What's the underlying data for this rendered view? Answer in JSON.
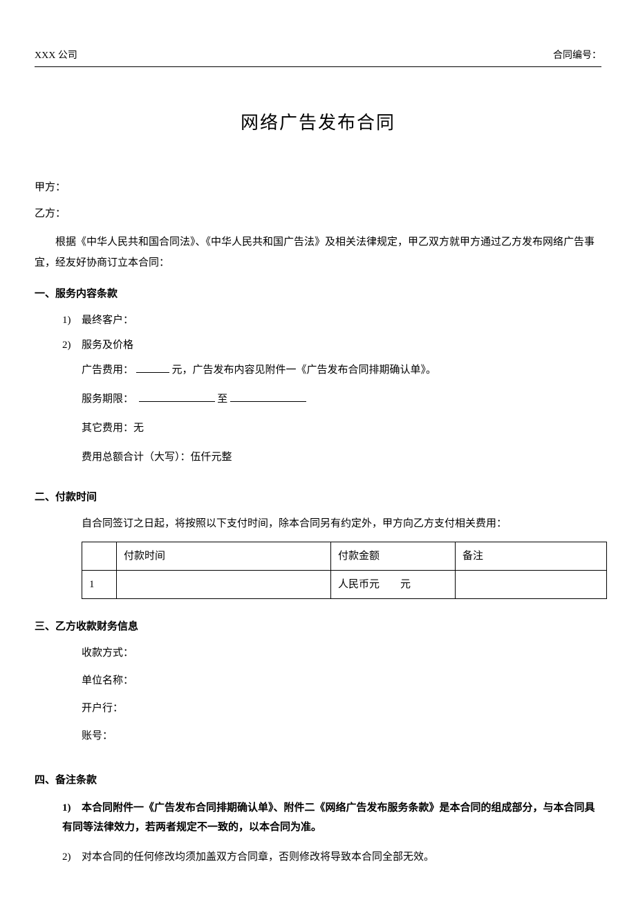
{
  "header": {
    "company": "XXX 公司",
    "contract_no_label": "合同编号："
  },
  "title": "网络广告发布合同",
  "parties": {
    "a": "甲方：",
    "b": "乙方："
  },
  "preamble": "根据《中华人民共和国合同法》、《中华人民共和国广告法》及相关法律规定，甲乙双方就甲方通过乙方发布网络广告事宜，经友好协商订立本合同：",
  "s1": {
    "heading": "一、服务内容条款",
    "i1_num": "1)",
    "i1_label": "最终客户：",
    "i2_num": "2)",
    "i2_label": "服务及价格",
    "fee_prefix": "广告费用：",
    "fee_suffix": "元，广告发布内容见附件一《广告发布合同排期确认单》。",
    "period_prefix": "服务期限：",
    "period_to": "至",
    "other_fee": "其它费用：无",
    "total": "费用总额合计（大写）：伍仟元整"
  },
  "s2": {
    "heading": "二、付款时间",
    "intro": "自合同签订之日起，将按照以下支付时间，除本合同另有约定外，甲方向乙方支付相关费用：",
    "th_time": "付款时间",
    "th_amt": "付款金额",
    "th_note": "备注",
    "row1_idx": "1",
    "row1_amt": "人民币元　　元"
  },
  "s3": {
    "heading": "三、乙方收款财务信息",
    "method": "收款方式：",
    "name": "单位名称：",
    "bank": "开户行：",
    "acct": "账号："
  },
  "s4": {
    "heading": "四、备注条款",
    "i1_num": "1)",
    "i1_text": "本合同附件一《广告发布合同排期确认单》、附件二《网络广告发布服务条款》是本合同的组成部分，与本合同具有同等法律效力，若两者规定不一致的，以本合同为准。",
    "i2_num": "2)",
    "i2_text": "对本合同的任何修改均须加盖双方合同章，否则修改将导致本合同全部无效。"
  }
}
